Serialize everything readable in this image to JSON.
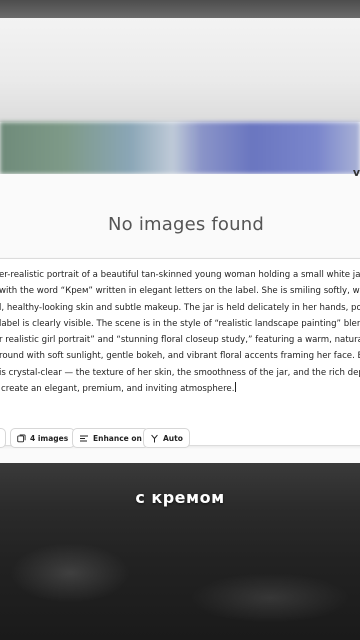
{
  "corner_letter": "v",
  "empty_state": {
    "title": "No images found"
  },
  "prompt": {
    "lines": [
      "er-realistic portrait of a beautiful tan-skinned young woman holding a small white ja",
      "with the word “Крем” written in elegant letters on the label. She is smiling softly, wi",
      "l, healthy-looking skin and subtle makeup. The jar is held delicately in her hands, po",
      "label is clearly visible. The scene is in the style of “realistic landscape painting” blend",
      "r realistic girl portrait” and “stunning floral closeup study,” featuring a warm, natural",
      "round with soft sunlight, gentle bokeh, and vibrant floral accents framing her face. E",
      "is crystal-clear — the texture of her skin, the smoothness of the jar, and the rich dept",
      "create an elegant, premium, and inviting atmosphere."
    ]
  },
  "toolbar": {
    "images_label": "4 images",
    "enhance_label": "Enhance on",
    "auto_label": "Auto"
  },
  "caption": "с кремом"
}
